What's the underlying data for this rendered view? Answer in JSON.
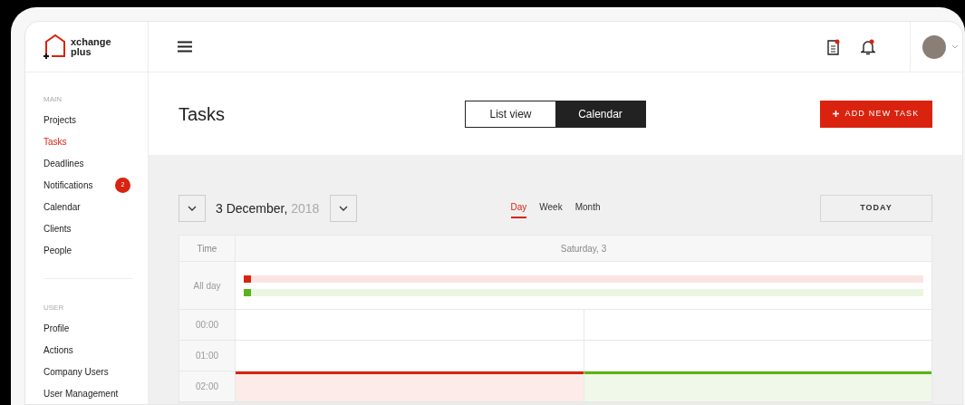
{
  "logo": {
    "line1": "xchange",
    "line2": "plus"
  },
  "sidebar": {
    "sections": [
      {
        "label": "MAIN",
        "items": [
          {
            "label": "Projects",
            "selected": false
          },
          {
            "label": "Tasks",
            "selected": true
          },
          {
            "label": "Deadlines",
            "selected": false
          },
          {
            "label": "Notifications",
            "selected": false,
            "badge": "2"
          },
          {
            "label": "Calendar",
            "selected": false
          },
          {
            "label": "Clients",
            "selected": false
          },
          {
            "label": "People",
            "selected": false
          }
        ]
      },
      {
        "label": "USER",
        "items": [
          {
            "label": "Profile",
            "selected": false
          },
          {
            "label": "Actions",
            "selected": false
          },
          {
            "label": "Company Users",
            "selected": false
          },
          {
            "label": "User Management",
            "selected": false
          }
        ]
      }
    ]
  },
  "topbar": {
    "icons": [
      {
        "kind": "document",
        "unread": true
      },
      {
        "kind": "bell",
        "unread": true
      }
    ]
  },
  "page": {
    "title": "Tasks",
    "view_toggle": [
      {
        "label": "List view",
        "selected": false
      },
      {
        "label": "Calendar",
        "selected": true
      }
    ],
    "add_button": "ADD NEW TASK"
  },
  "calendar": {
    "date": "3 December,",
    "year": "2018",
    "ranges": [
      {
        "label": "Day",
        "selected": true
      },
      {
        "label": "Week",
        "selected": false
      },
      {
        "label": "Month",
        "selected": false
      }
    ],
    "today_button": "TODAY",
    "time_header": "Time",
    "day_header": "Saturday, 3",
    "all_day_label": "All day",
    "all_day_events": [
      {
        "color": "#d9230f"
      },
      {
        "color": "#5cb314"
      }
    ],
    "hours": [
      {
        "label": "00:00",
        "cells": [
          {
            "kind": "free"
          },
          {
            "kind": "free"
          }
        ]
      },
      {
        "label": "01:00",
        "cells": [
          {
            "kind": "free"
          },
          {
            "kind": "free"
          }
        ]
      },
      {
        "label": "02:00",
        "cells": [
          {
            "kind": "event",
            "color": "#d9230f"
          },
          {
            "kind": "event",
            "color": "#5cb314"
          }
        ]
      }
    ]
  }
}
